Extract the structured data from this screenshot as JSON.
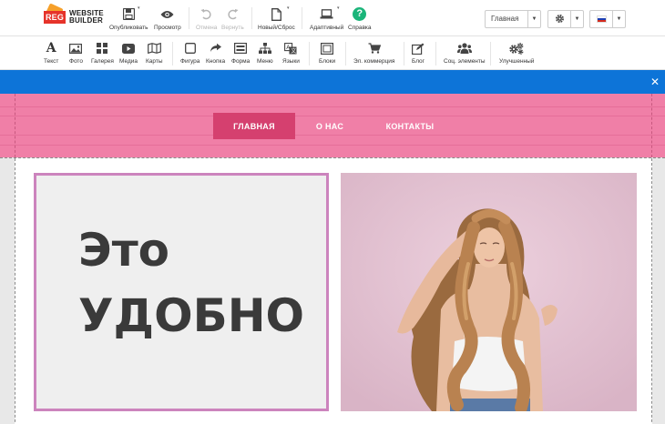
{
  "logo": {
    "mark": "REG",
    "line1": "WEBSITE",
    "line2": "BUILDER"
  },
  "toolbar": {
    "publish": "Опубликовать",
    "preview": "Просмотр",
    "undo": "Отмена",
    "redo": "Вернуть",
    "new_reset": "Новый/Сброс",
    "adaptive": "Адаптивный",
    "help": "Справка"
  },
  "page_select": {
    "value": "Главная"
  },
  "elements": {
    "text": "Текст",
    "photo": "Фото",
    "gallery": "Галерея",
    "media": "Медиа",
    "maps": "Карты",
    "shape": "Фигура",
    "button": "Кнопка",
    "form": "Форма",
    "menu": "Меню",
    "languages": "Языки",
    "blocks": "Блоки",
    "ecommerce": "Эл. коммерция",
    "blog": "Блог",
    "social": "Соц. элементы",
    "advanced": "Улучшенный"
  },
  "site_nav": {
    "home": "ГЛАВНАЯ",
    "about": "О НАС",
    "contacts": "КОНТАКТЫ"
  },
  "hero": {
    "line1": "Это",
    "line2": "УДОБНО"
  },
  "colors": {
    "header_pink": "#f07fa7",
    "nav_active": "#d5406f",
    "frame_border": "#cc84bd",
    "notice_blue": "#0d74d8",
    "help_green": "#1bb57a"
  }
}
